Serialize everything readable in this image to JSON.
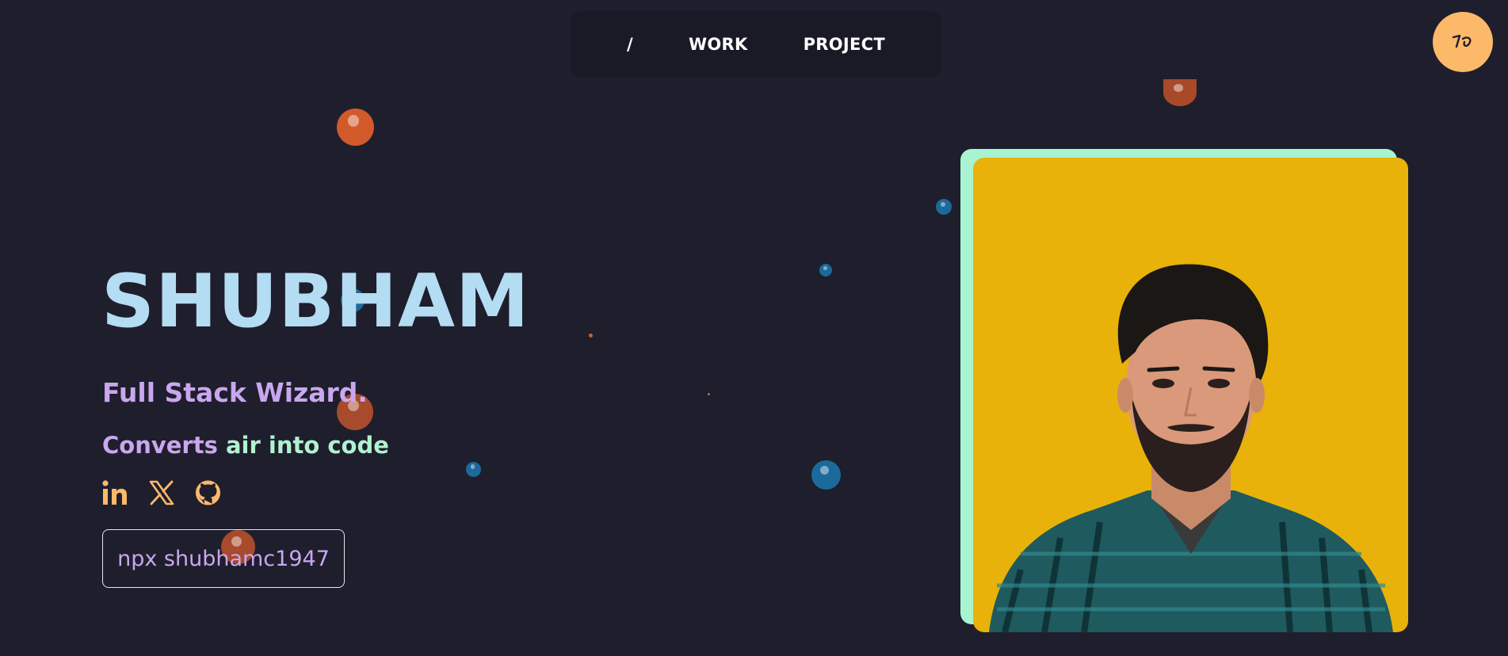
{
  "nav": {
    "home_label": "/",
    "work_label": "WORK",
    "project_label": "PROJECT"
  },
  "logo": {
    "text": "ᕴ"
  },
  "hero": {
    "name": "SHUBHAM",
    "tagline": "Full Stack Wizard.",
    "converts_word": "Converts",
    "air_into_code": "air into code",
    "npx_command": "npx shubhamc1947"
  },
  "social": {
    "icons": [
      "linkedin-icon",
      "x-icon",
      "github-icon"
    ]
  },
  "colors": {
    "background": "#1f1e2d",
    "name": "#b4dcf2",
    "accent_purple": "#c9a7ee",
    "accent_green": "#b0f2cf",
    "accent_orange": "#fdb96a",
    "photo_bg": "#e8b20a",
    "photo_frame": "#a8f4d0"
  }
}
